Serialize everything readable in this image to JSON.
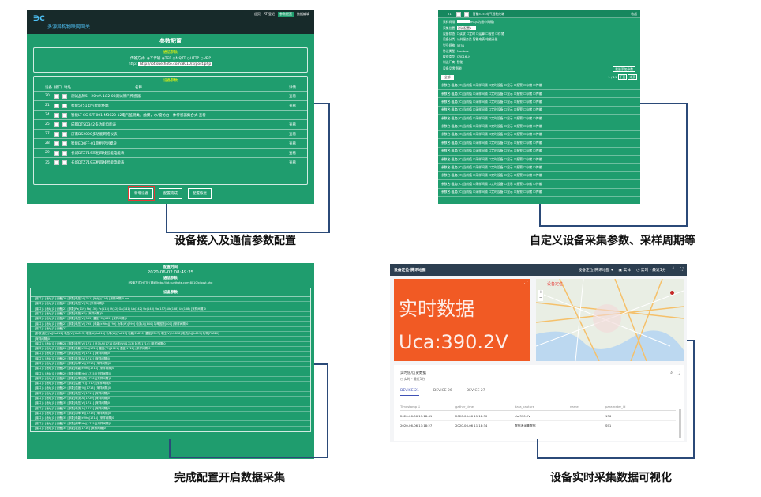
{
  "captions": {
    "c1": "设备接入及通信参数配置",
    "c2": "自定义设备采集参数、采样周期等",
    "c3": "完成配置开启数据采集",
    "c4": "设备实时采集数据可视化"
  },
  "panel1": {
    "logo": "∋C",
    "subtitle": "多源异构物联网网关",
    "nav": [
      "首页",
      "AT 登记",
      "参数配置",
      "数据编辑"
    ],
    "title": "参数配置",
    "comm_title": "通信参数",
    "protocol_label": "传输方式:",
    "protocols": [
      "不传输",
      "TCP",
      "MQTT",
      "HTTP",
      "UDP"
    ],
    "url_label": "http:",
    "url_value": "http://iot.suethote.com:8010/x/post.php",
    "dev_title": "设备参数",
    "cols": [
      "设备",
      "接口",
      "地址",
      "名称",
      "详情"
    ],
    "rows": [
      {
        "id": "20",
        "name": "测试品牌5 - 20mA 1&2-03测试蒸汽传感器",
        "act": "查看"
      },
      {
        "id": "21",
        "name": "智能5751电气智能终端",
        "act": "查看"
      },
      {
        "id": "24",
        "name": "智能LT-CG-5/T-001-M3020-12电气监测类，触摸，水/度仿台一体传感器集合式 查看",
        "act": ""
      },
      {
        "id": "25",
        "name": "成都DTSD342多功能电能表",
        "act": "查看"
      },
      {
        "id": "27",
        "name": "济南DS200C多功能网络仪表",
        "act": "查看"
      },
      {
        "id": "28",
        "name": "智能ED0FF-01单相控制模块",
        "act": "查看"
      },
      {
        "id": "29",
        "name": "长城DTZ719三相四线智能电能表",
        "act": "查看"
      },
      {
        "id": "35",
        "name": "长城DTZ719三相四线智能电能表",
        "act": "查看"
      }
    ],
    "buttons": [
      "新增设备",
      "配置完成",
      "配置恢复"
    ]
  },
  "panel2": {
    "header_id": "21",
    "header_name": "智能5751电气智能终端",
    "header_close": "收起",
    "fields": [
      [
        "采样间隔:",
        "",
        "ms(0为最小间隔)"
      ],
      [
        "采集位置:",
        "测试配置1",
        ""
      ],
      [
        "设备状态:",
        "☐读取 ☐定时 ☐运算 ☐报警 ☐存储",
        ""
      ],
      [
        "设备分类:",
        "公共服务类 智能电表 电能计量",
        ""
      ],
      [
        "型号规格:",
        "5751",
        ""
      ],
      [
        "协议类型:",
        "Modbus",
        ""
      ],
      [
        "校验类型:",
        "CRC16LH",
        ""
      ],
      [
        "制造厂商:",
        "智能",
        ""
      ],
      [
        "设备品牌:",
        "智能",
        ""
      ]
    ],
    "add_label": "批量添加参数",
    "page_label": "1 / 11",
    "prev_label": "下页",
    "next_label": "末页",
    "select_label": "全部",
    "item_text": "参数名:温度(℃)当前值 ☐采样间隔 ☐定时设备 ☐显示 ☐报警 ☐存储 ☐传输",
    "item_count": 14
  },
  "panel3": {
    "title": "配置时间",
    "time": "2020-06-02 08:49:25",
    "param_title": "通信参数",
    "param_line": "[传输方式]HTTP [网址]http://iot.suethote.com:8010/x/post.php",
    "dev_title": "设备参数",
    "lines": [
      "[接口]1 [地址]1 [设备]29 [参数]电压(V)[711] [地址](716) [采样间隔]0 ms",
      "[接口]1 [地址]1 [设备]21 [参数]电压(V)[R] [采样间隔]0",
      "[接口]1 [地址]1 [设备]21 [参数]Pa(119) Pb(130) Pc(113) PI(12) Ga(141) Ub(142) Uc(143) Ua(157) Ub(158) Uc(158) [采样间隔]0",
      "[接口]1 [地址]1 [设备]21 [参数]电能(KO) [采样间隔]0",
      "[接口]1 [地址]1 [设备]27 [参数]电压(V)[565] 温度(℃)[665] [采样间隔]0",
      "[接口]1 [地址]1 [设备]27 [参数]电压(V)[795] [电能(kWh)][799] 功率(W)[799] 电流(A)[800] 功率因数[801] [采样间隔]0",
      "[接口]1 [地址]1 [设备]27",
      "[参数]电压(V)[Ua812] 电压(V)[Ub813] 电流(A)[Ia814] 功率(W)[Pa815] 电能[Ea816] 温度[T817] 电压(V)[Uc818] 电流(A)[Ib819] 功率[Pb820]",
      "[采样间隔]0",
      "[接口]1 [地址]1 [设备]28 [参数]电压(V)[1711] 电流(A)[1712] 功率(W)[1713] 状态[1714] [采样间隔]0",
      "[接口]1 [地址]1 [设备]28 [参数]电能(kWh)[1720] 温度(℃)[1721] 湿度[1722] [采样间隔]0",
      "[接口]1 [地址]1 [设备]29 [参数]电压(V)[1711] [采样间隔]0",
      "[接口]1 [地址]1 [设备]29 [参数]电流(A)[1712] [采样间隔]0",
      "[接口]1 [地址]1 [设备]29 [参数]功率(W)[1713] [采样间隔]0",
      "[接口]1 [地址]1 [设备]29 [参数]电能(kWh)[1714] [采样间隔]0",
      "[接口]1 [地址]1 [设备]29 [参数]频率(Hz)[1715] [采样间隔]0",
      "[接口]1 [地址]1 [设备]29 [参数]功率因数[1716] [采样间隔]0",
      "[接口]1 [地址]1 [设备]29 [参数]温度(℃)[1717] [采样间隔]0",
      "[接口]1 [地址]1 [设备]29 [参数]湿度(%)[1718] [采样间隔]0",
      "[接口]1 [地址]1 [设备]29 [参数]电压(V)[1719] [采样间隔]0",
      "[接口]1 [地址]1 [设备]29 [参数]电流(A)[1720] [采样间隔]0",
      "[接口]1 [地址]1 [设备]35 [参数]电压(V)[1711] [采样间隔]0",
      "[接口]1 [地址]1 [设备]35 [参数]电流(A)[1712] [采样间隔]0",
      "[接口]1 [地址]1 [设备]35 [参数]功率(W)[1713] [采样间隔]0",
      "[接口]1 [地址]1 [设备]35 [参数]电能(kWh)[1714] [采样间隔]0",
      "[接口]1 [地址]1 [设备]35 [参数]频率(Hz)[1715] [采样间隔]0",
      "[接口]1 [地址]1 [设备]35 [参数]状态[1716] [采样间隔]0"
    ]
  },
  "panel4": {
    "title": "设备定位-腾讯地图",
    "header_menu": "设备定位-腾讯地图 ▾",
    "header_items": [
      "实体",
      "实时 - 最近1分"
    ],
    "rt_title": "实时数据",
    "rt_value": "Uca:390.2V",
    "map_title": "设备定位",
    "table_title": "实时值/历史数据",
    "table_sub": "实时 - 最近1分",
    "tabs": [
      "DEVICE 21",
      "DEVICE 26",
      "DEVICE 27"
    ],
    "cols": [
      "Timestamp ↓",
      "gather_time",
      "data_capture",
      "name",
      "parameter_id"
    ],
    "rows": [
      [
        "2020-06-06 11:18:41",
        "2020-06-06 11:18:30",
        "Ua:390.2V",
        "",
        "136"
      ],
      [
        "2020-06-06 11:18:27",
        "2020-06-06 11:18:34",
        "数据未采集数据",
        "",
        "S91"
      ]
    ],
    "accent": "#f15a24"
  }
}
